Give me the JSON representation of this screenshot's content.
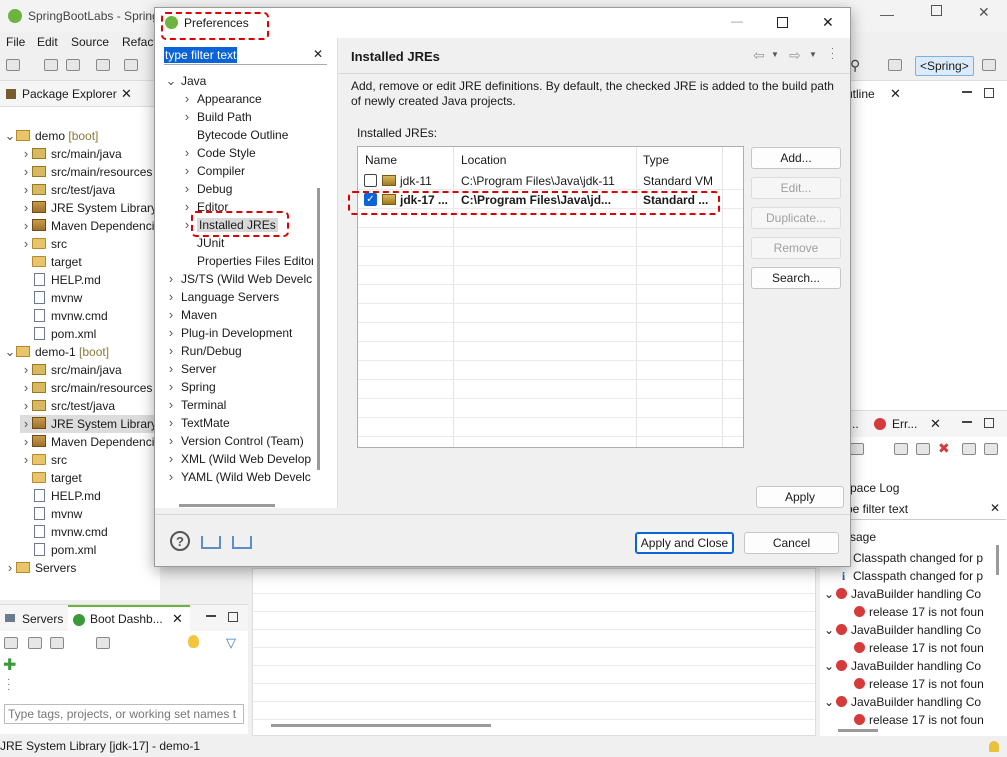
{
  "app": {
    "title": "SpringBootLabs - Spring",
    "status_text": "JRE System Library [jdk-17] - demo-1"
  },
  "menu": [
    "File",
    "Edit",
    "Source",
    "Refact"
  ],
  "toolbar": {
    "perspective": "<Spring>"
  },
  "package_explorer": {
    "tab_label": "Package Explorer",
    "items": [
      {
        "label": "demo",
        "suffix": " [boot]"
      },
      {
        "label": "src/main/java"
      },
      {
        "label": "src/main/resources"
      },
      {
        "label": "src/test/java"
      },
      {
        "label": "JRE System Library"
      },
      {
        "label": "Maven Dependencies"
      },
      {
        "label": "src"
      },
      {
        "label": "target"
      },
      {
        "label": "HELP.md"
      },
      {
        "label": "mvnw"
      },
      {
        "label": "mvnw.cmd"
      },
      {
        "label": "pom.xml"
      },
      {
        "label": "demo-1",
        "suffix": " [boot]"
      },
      {
        "label": "src/main/java"
      },
      {
        "label": "src/main/resources"
      },
      {
        "label": "src/test/java"
      },
      {
        "label": "JRE System Library"
      },
      {
        "label": "Maven Dependencies"
      },
      {
        "label": "src"
      },
      {
        "label": "target"
      },
      {
        "label": "HELP.md"
      },
      {
        "label": "mvnw"
      },
      {
        "label": "mvnw.cmd"
      },
      {
        "label": "pom.xml"
      },
      {
        "label": "Servers"
      }
    ]
  },
  "servers_panel": {
    "tab1": "Servers",
    "tab2": "Boot Dashb...",
    "filter_placeholder": "Type tags, projects, or working set names t"
  },
  "outline": {
    "tab_label": "utline"
  },
  "error_log": {
    "tab1": "i...",
    "tab2": "Err...",
    "title": "pace Log",
    "filter_text": "pe filter text",
    "column": "sage",
    "rows": [
      {
        "type": "info",
        "indent": 0,
        "text": "Classpath changed for p"
      },
      {
        "type": "info",
        "indent": 0,
        "text": "Classpath changed for p"
      },
      {
        "type": "error",
        "indent": 0,
        "text": "JavaBuilder handling Co"
      },
      {
        "type": "error",
        "indent": 1,
        "text": "release 17 is not foun"
      },
      {
        "type": "error",
        "indent": 0,
        "text": "JavaBuilder handling Co"
      },
      {
        "type": "error",
        "indent": 1,
        "text": "release 17 is not foun"
      },
      {
        "type": "error",
        "indent": 0,
        "text": "JavaBuilder handling Co"
      },
      {
        "type": "error",
        "indent": 1,
        "text": "release 17 is not foun"
      },
      {
        "type": "error",
        "indent": 0,
        "text": "JavaBuilder handling Co"
      },
      {
        "type": "error",
        "indent": 1,
        "text": "release 17 is not foun"
      }
    ]
  },
  "dialog": {
    "title": "Preferences",
    "filter_value": "type filter text",
    "tree": [
      {
        "label": "Java",
        "level": 0,
        "arrow": "down"
      },
      {
        "label": "Appearance",
        "level": 1,
        "arrow": "right"
      },
      {
        "label": "Build Path",
        "level": 1,
        "arrow": "right"
      },
      {
        "label": "Bytecode Outline",
        "level": 1,
        "arrow": ""
      },
      {
        "label": "Code Style",
        "level": 1,
        "arrow": "right"
      },
      {
        "label": "Compiler",
        "level": 1,
        "arrow": "right"
      },
      {
        "label": "Debug",
        "level": 1,
        "arrow": "right"
      },
      {
        "label": "Editor",
        "level": 1,
        "arrow": "right"
      },
      {
        "label": "Installed JREs",
        "level": 1,
        "arrow": "right",
        "selected": true
      },
      {
        "label": "JUnit",
        "level": 1,
        "arrow": ""
      },
      {
        "label": "Properties Files Editor",
        "level": 1,
        "arrow": ""
      },
      {
        "label": "JS/TS (Wild Web Develc",
        "level": 0,
        "arrow": "right"
      },
      {
        "label": "Language Servers",
        "level": 0,
        "arrow": "right"
      },
      {
        "label": "Maven",
        "level": 0,
        "arrow": "right"
      },
      {
        "label": "Plug-in Development",
        "level": 0,
        "arrow": "right"
      },
      {
        "label": "Run/Debug",
        "level": 0,
        "arrow": "right"
      },
      {
        "label": "Server",
        "level": 0,
        "arrow": "right"
      },
      {
        "label": "Spring",
        "level": 0,
        "arrow": "right"
      },
      {
        "label": "Terminal",
        "level": 0,
        "arrow": "right"
      },
      {
        "label": "TextMate",
        "level": 0,
        "arrow": "right"
      },
      {
        "label": "Version Control (Team)",
        "level": 0,
        "arrow": "right"
      },
      {
        "label": "XML (Wild Web Develop",
        "level": 0,
        "arrow": "right"
      },
      {
        "label": "YAML (Wild Web Develc",
        "level": 0,
        "arrow": "right"
      }
    ],
    "page_title": "Installed JREs",
    "description": "Add, remove or edit JRE definitions. By default, the checked JRE is added to the build path of newly created Java projects.",
    "table_label": "Installed JREs:",
    "columns": [
      "Name",
      "Location",
      "Type"
    ],
    "jres": [
      {
        "name": "jdk-11",
        "location": "C:\\Program Files\\Java\\jdk-11",
        "type": "Standard VM",
        "checked": false,
        "bold": false
      },
      {
        "name": "jdk-17 ...",
        "location": "C:\\Program Files\\Java\\jd...",
        "type": "Standard ...",
        "checked": true,
        "bold": true
      }
    ],
    "buttons": {
      "add": "Add...",
      "edit": "Edit...",
      "duplicate": "Duplicate...",
      "remove": "Remove",
      "search": "Search...",
      "apply": "Apply",
      "apply_close": "Apply and Close",
      "cancel": "Cancel"
    },
    "window_controls": [
      "—",
      "□",
      "✕"
    ]
  },
  "colors": {
    "highlight": "#e00000",
    "selection": "#cce8ff",
    "link_blue": "#0060c0"
  }
}
